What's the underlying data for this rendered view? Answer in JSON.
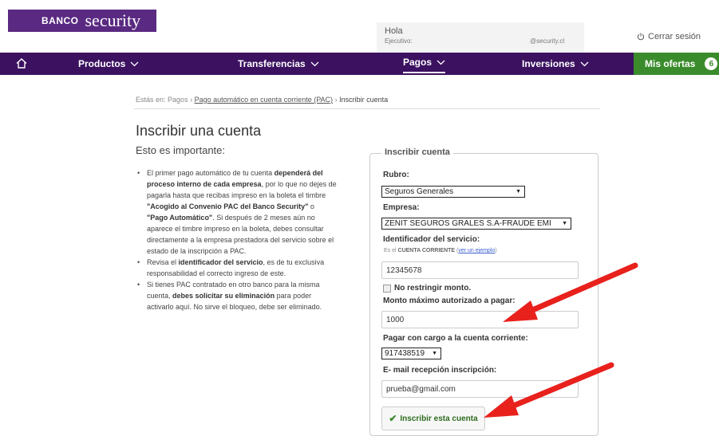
{
  "brand": {
    "banco": "BANCO",
    "security": "security"
  },
  "header": {
    "greeting": "Hola",
    "ejecutivo_label": "Ejecutivo:",
    "email_domain": "@security.cl",
    "logout": "Cerrar sesión"
  },
  "nav": {
    "items": [
      {
        "label": "Productos"
      },
      {
        "label": "Transferencias"
      },
      {
        "label": "Pagos"
      },
      {
        "label": "Inversiones"
      }
    ],
    "offers_label": "Mis ofertas",
    "offers_count": "6"
  },
  "breadcrumb": {
    "prefix": "Estás en:",
    "level1": "Pagos",
    "level2": "Pago automático en cuenta corriente (PAC)",
    "current": "Inscribir cuenta"
  },
  "page": {
    "title": "Inscribir una cuenta",
    "subtitle": "Esto es importante:"
  },
  "bullets": {
    "b1_a": "El primer pago automático de tu cuenta ",
    "b1_b": "dependerá del proceso interno de cada empresa",
    "b1_c": ", por lo que no dejes de pagarla hasta que recibas impreso en la boleta el timbre ",
    "b1_d": "\"Acogido al Convenio PAC del Banco Security\"",
    "b1_e": " o ",
    "b1_f": "\"Pago Automático\"",
    "b1_g": ". Si después de 2 meses aún no aparece el timbre impreso en la boleta, debes consultar directamente a la empresa prestadora del servicio sobre el estado de la inscripción a PAC.",
    "b2_a": "Revisa el ",
    "b2_b": "identificador del servicio",
    "b2_c": ", es de tu exclusiva responsabilidad el correcto ingreso de este.",
    "b3_a": "Si tienes PAC contratado en otro banco para la misma cuenta, ",
    "b3_b": "debes solicitar su eliminación",
    "b3_c": " para poder activarlo aquí. No sirve el bloqueo, debe ser eliminado."
  },
  "form": {
    "legend": "Inscribir cuenta",
    "rubro_label": "Rubro:",
    "rubro_value": "Seguros Generales",
    "empresa_label": "Empresa:",
    "empresa_value": "ZENIT SEGUROS GRALES S.A-FRAUDE EMI",
    "identificador_label": "Identificador del servicio:",
    "hint_prefix": "Es el ",
    "hint_bold": "CUENTA CORRIENTE",
    "hint_link": "ver un ejemplo",
    "identificador_value": "12345678",
    "no_restringir_label": "No restringir monto.",
    "monto_label": "Monto máximo autorizado a pagar:",
    "monto_value": "1000",
    "cuenta_label": "Pagar con cargo a la cuenta corriente:",
    "cuenta_value": "917438519",
    "email_label": "E- mail recepción inscripción:",
    "email_value": "prueba@gmail.com",
    "submit_label": "Inscribir esta cuenta"
  },
  "colors": {
    "brand_purple": "#5a2a82",
    "nav_purple": "#3b1160",
    "offers_green": "#3a8b2c",
    "annotation_red": "#e8211d"
  }
}
